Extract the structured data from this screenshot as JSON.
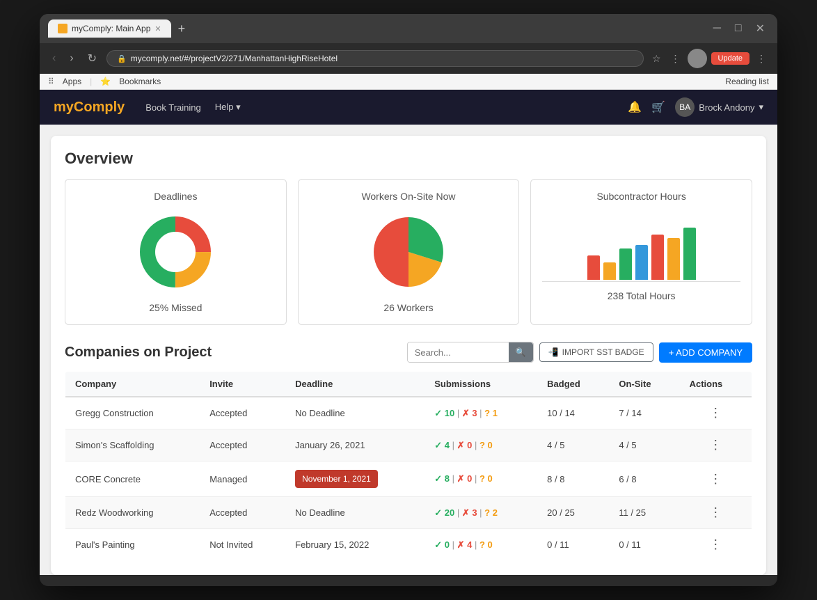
{
  "browser": {
    "tab_title": "myComply: Main App",
    "url": "mycomply.net/#/projectV2/271/ManhattanHighRiseHotel",
    "new_tab_label": "+",
    "bookmarks_label": "Bookmarks",
    "apps_label": "Apps",
    "reading_list_label": "Reading list",
    "update_button": "Update",
    "nav_back": "‹",
    "nav_forward": "›",
    "nav_refresh": "↻"
  },
  "topnav": {
    "logo_my": "my",
    "logo_comply": "Comply",
    "book_training": "Book Training",
    "help": "Help",
    "user_name": "Brock Andony",
    "user_initials": "BA"
  },
  "overview": {
    "section_title": "Overview",
    "deadlines_card": {
      "title": "Deadlines",
      "subtitle": "25% Missed",
      "donut": {
        "green_pct": 50,
        "yellow_pct": 25,
        "red_pct": 25
      }
    },
    "workers_card": {
      "title": "Workers On-Site Now",
      "subtitle": "26 Workers",
      "pie": {
        "green_pct": 40,
        "yellow_pct": 20,
        "red_pct": 40
      }
    },
    "hours_card": {
      "title": "Subcontractor Hours",
      "subtitle": "238 Total Hours",
      "bars": [
        {
          "color": "#e74c3c",
          "height": 35
        },
        {
          "color": "#f5a623",
          "height": 25
        },
        {
          "color": "#27ae60",
          "height": 45
        },
        {
          "color": "#3498db",
          "height": 50
        },
        {
          "color": "#e74c3c",
          "height": 65
        },
        {
          "color": "#f5a623",
          "height": 60
        },
        {
          "color": "#27ae60",
          "height": 75
        }
      ]
    }
  },
  "companies": {
    "section_title": "Companies on Project",
    "search_placeholder": "Search...",
    "import_sst_label": "IMPORT SST BADGE",
    "add_company_label": "+ ADD COMPANY",
    "table": {
      "headers": [
        "Company",
        "Invite",
        "Deadline",
        "Submissions",
        "Badged",
        "On-Site",
        "Actions"
      ],
      "rows": [
        {
          "company": "Gregg Construction",
          "invite": "Accepted",
          "deadline": "No Deadline",
          "deadline_red": false,
          "submissions": {
            "green": "✓ 10",
            "red": "✗ 3",
            "orange": "? 1"
          },
          "badged": "10 / 14",
          "onsite": "7 / 14"
        },
        {
          "company": "Simon's Scaffolding",
          "invite": "Accepted",
          "deadline": "January 26, 2021",
          "deadline_red": false,
          "submissions": {
            "green": "✓ 4",
            "red": "✗ 0",
            "orange": "? 0"
          },
          "badged": "4 / 5",
          "onsite": "4 / 5"
        },
        {
          "company": "CORE Concrete",
          "invite": "Managed",
          "deadline": "November 1, 2021",
          "deadline_red": true,
          "submissions": {
            "green": "✓ 8",
            "red": "✗ 0",
            "orange": "? 0"
          },
          "badged": "8 / 8",
          "onsite": "6 / 8"
        },
        {
          "company": "Redz Woodworking",
          "invite": "Accepted",
          "deadline": "No Deadline",
          "deadline_red": false,
          "submissions": {
            "green": "✓ 20",
            "red": "✗ 3",
            "orange": "? 2"
          },
          "badged": "20 / 25",
          "onsite": "11 / 25"
        },
        {
          "company": "Paul's Painting",
          "invite": "Not Invited",
          "deadline": "February 15, 2022",
          "deadline_red": false,
          "submissions": {
            "green": "✓ 0",
            "red": "✗ 4",
            "orange": "? 0"
          },
          "badged": "0 / 11",
          "onsite": "0 / 11"
        }
      ]
    }
  },
  "colors": {
    "green": "#27ae60",
    "red": "#e74c3c",
    "yellow": "#f5a623",
    "blue": "#3498db",
    "navy": "#1a1a2e"
  }
}
